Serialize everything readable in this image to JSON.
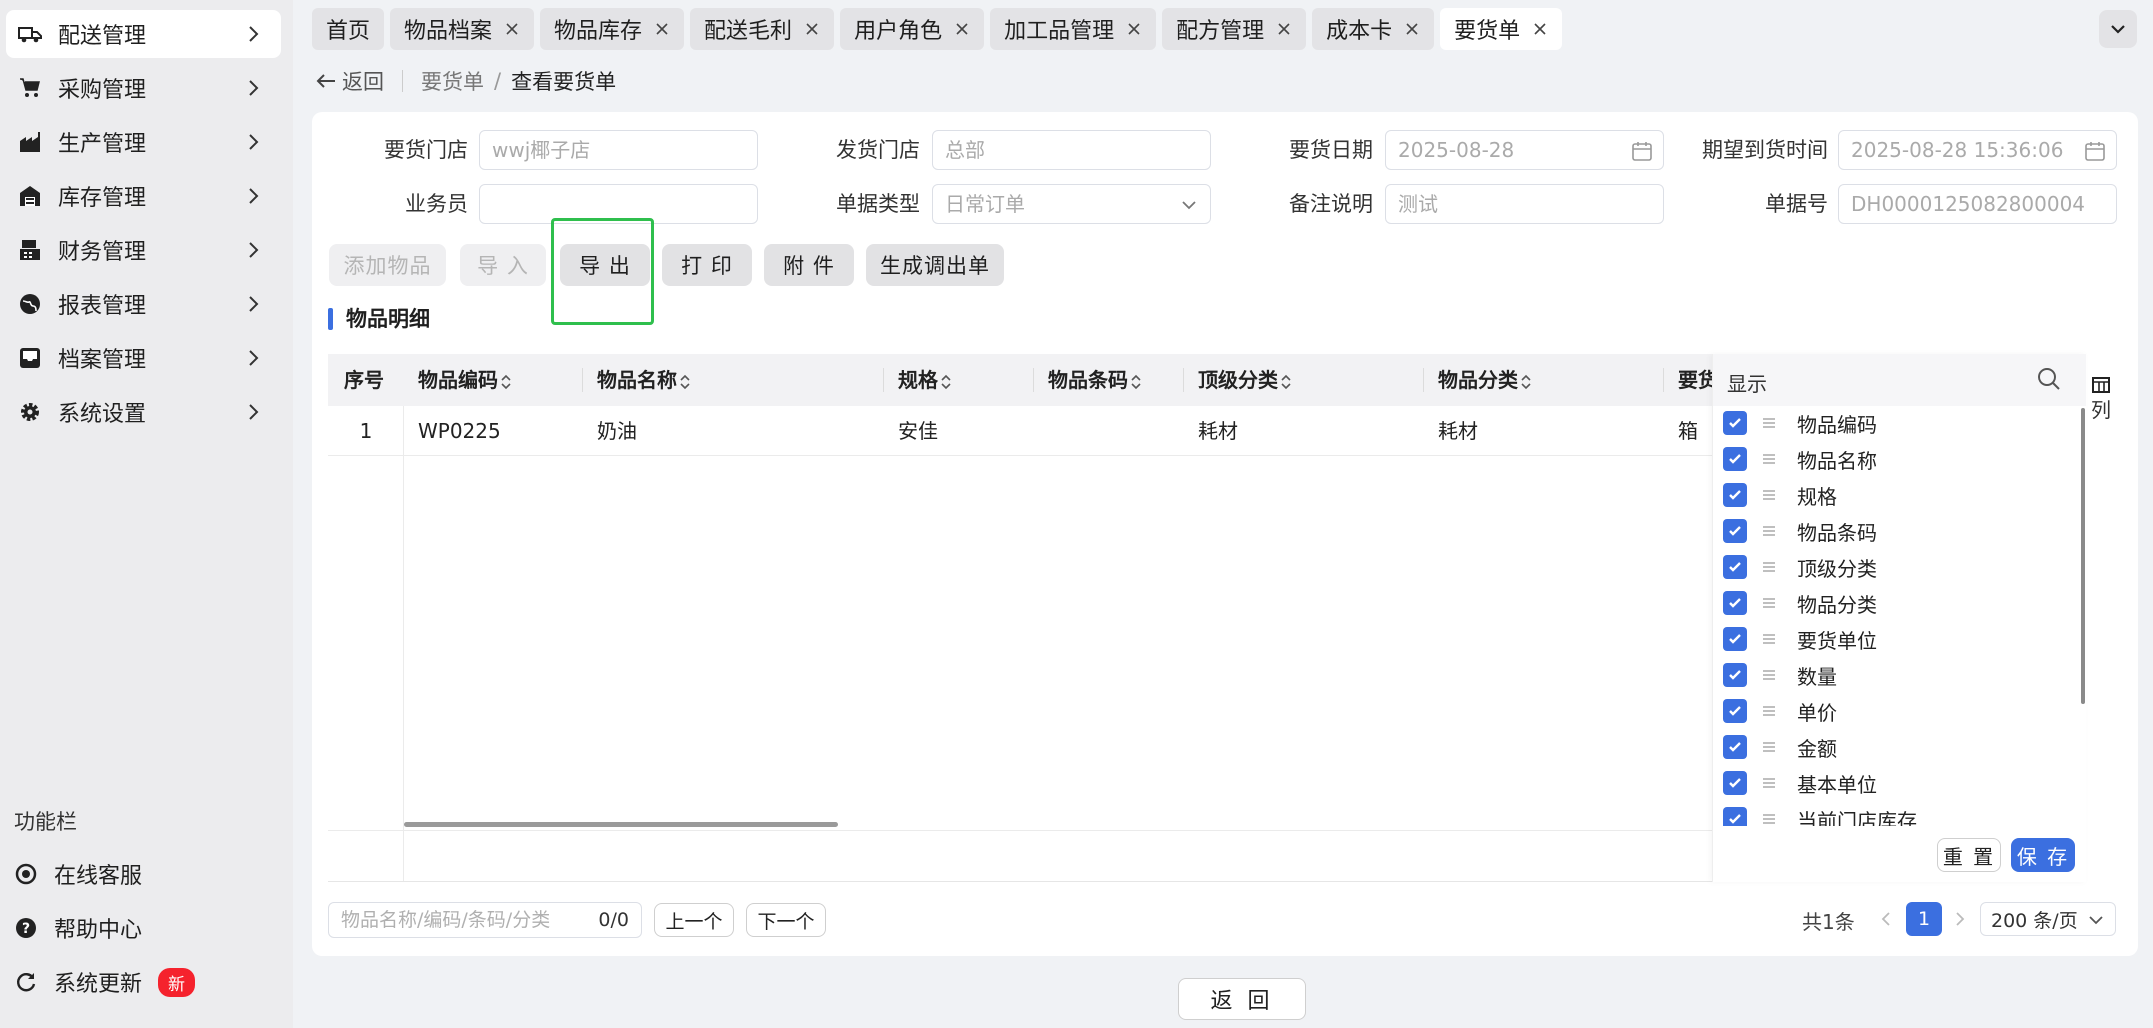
{
  "sidebar": {
    "menu": [
      {
        "label": "配送管理",
        "icon": "truck-icon"
      },
      {
        "label": "采购管理",
        "icon": "cart-icon"
      },
      {
        "label": "生产管理",
        "icon": "factory-icon"
      },
      {
        "label": "库存管理",
        "icon": "warehouse-icon"
      },
      {
        "label": "财务管理",
        "icon": "register-icon"
      },
      {
        "label": "报表管理",
        "icon": "globe-icon"
      },
      {
        "label": "档案管理",
        "icon": "inbox-icon"
      },
      {
        "label": "系统设置",
        "icon": "gear-icon"
      }
    ],
    "func_title": "功能栏",
    "func_items": [
      {
        "label": "在线客服",
        "icon": "headset-icon"
      },
      {
        "label": "帮助中心",
        "icon": "help-icon"
      },
      {
        "label": "系统更新",
        "icon": "refresh-icon",
        "badge": "新"
      }
    ]
  },
  "tabs": [
    {
      "label": "首页",
      "closable": false
    },
    {
      "label": "物品档案",
      "closable": true
    },
    {
      "label": "物品库存",
      "closable": true
    },
    {
      "label": "配送毛利",
      "closable": true
    },
    {
      "label": "用户角色",
      "closable": true
    },
    {
      "label": "加工品管理",
      "closable": true
    },
    {
      "label": "配方管理",
      "closable": true
    },
    {
      "label": "成本卡",
      "closable": true
    },
    {
      "label": "要货单",
      "closable": true,
      "active": true
    }
  ],
  "breadcrumb": {
    "back": "返回",
    "parent": "要货单",
    "separator": "/",
    "current": "查看要货单"
  },
  "form": {
    "store_label": "要货门店",
    "store_value": "wwj椰子店",
    "ship_label": "发货门店",
    "ship_value": "总部",
    "date_label": "要货日期",
    "date_value": "2025-08-28",
    "expect_label": "期望到货时间",
    "expect_value": "2025-08-28 15:36:06",
    "staff_label": "业务员",
    "staff_value": "",
    "type_label": "单据类型",
    "type_value": "日常订单",
    "remark_label": "备注说明",
    "remark_value": "测试",
    "no_label": "单据号",
    "no_value": "DH0000125082800004"
  },
  "toolbar": {
    "add": "添加物品",
    "import": "导 入",
    "export": "导 出",
    "print": "打 印",
    "attach": "附 件",
    "transfer": "生成调出单"
  },
  "section_title": "物品明细",
  "table": {
    "headers": [
      "序号",
      "物品编码",
      "物品名称",
      "规格",
      "物品条码",
      "顶级分类",
      "物品分类",
      "要货"
    ],
    "rows": [
      [
        "1",
        "WP0225",
        "奶油",
        "安佳",
        "",
        "耗材",
        "耗材",
        "箱"
      ]
    ]
  },
  "column_panel": {
    "title": "显示",
    "items": [
      "物品编码",
      "物品名称",
      "规格",
      "物品条码",
      "顶级分类",
      "物品分类",
      "要货单位",
      "数量",
      "单价",
      "金额",
      "基本单位",
      "当前门店库存"
    ],
    "reset": "重 置",
    "save": "保 存",
    "toggle_label": "列"
  },
  "footer": {
    "search_placeholder": "物品名称/编码/条码/分类",
    "search_count": "0/0",
    "prev": "上一个",
    "next": "下一个",
    "total": "共1条",
    "page": "1",
    "page_size": "200 条/页"
  },
  "bottom_return": "返 回",
  "colors": {
    "accent": "#3b6fe0",
    "highlight": "#2fbf4d",
    "badge": "#f5222d"
  }
}
